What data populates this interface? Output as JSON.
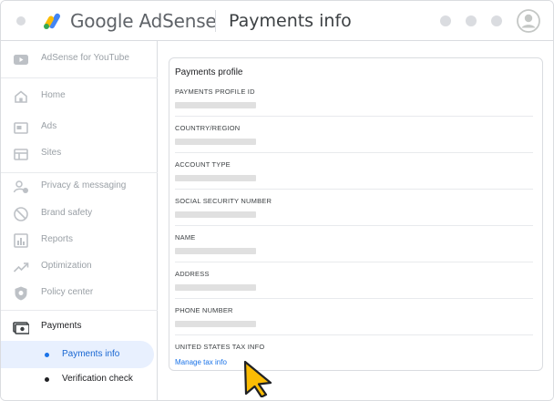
{
  "header": {
    "brand_google": "Google",
    "brand_product": "AdSense",
    "page_title": "Payments info"
  },
  "sidebar": {
    "items": [
      {
        "label": "AdSense for YouTube",
        "icon": "youtube-icon"
      },
      {
        "label": "Home",
        "icon": "home-icon"
      },
      {
        "label": "Ads",
        "icon": "ads-icon"
      },
      {
        "label": "Sites",
        "icon": "sites-icon"
      },
      {
        "label": "Privacy & messaging",
        "icon": "privacy-icon"
      },
      {
        "label": "Brand safety",
        "icon": "block-icon"
      },
      {
        "label": "Reports",
        "icon": "reports-icon"
      },
      {
        "label": "Optimization",
        "icon": "trending-icon"
      },
      {
        "label": "Policy center",
        "icon": "shield-icon"
      },
      {
        "label": "Payments",
        "icon": "payments-icon"
      }
    ],
    "sub_items": [
      {
        "label": "Payments info",
        "selected": true
      },
      {
        "label": "Verification check",
        "selected": false
      }
    ]
  },
  "card": {
    "title": "Payments profile",
    "fields": [
      {
        "label": "PAYMENTS PROFILE ID"
      },
      {
        "label": "COUNTRY/REGION"
      },
      {
        "label": "ACCOUNT TYPE"
      },
      {
        "label": "SOCIAL SECURITY NUMBER"
      },
      {
        "label": "NAME"
      },
      {
        "label": "ADDRESS"
      },
      {
        "label": "PHONE NUMBER"
      },
      {
        "label": "UNITED STATES TAX INFO"
      }
    ],
    "link": "Manage tax info"
  },
  "colors": {
    "accent": "#1a73e8",
    "selected_bg": "#e8f0fe",
    "cursor": "#fbbc04",
    "placeholder_bar": "#e0e0e0"
  }
}
